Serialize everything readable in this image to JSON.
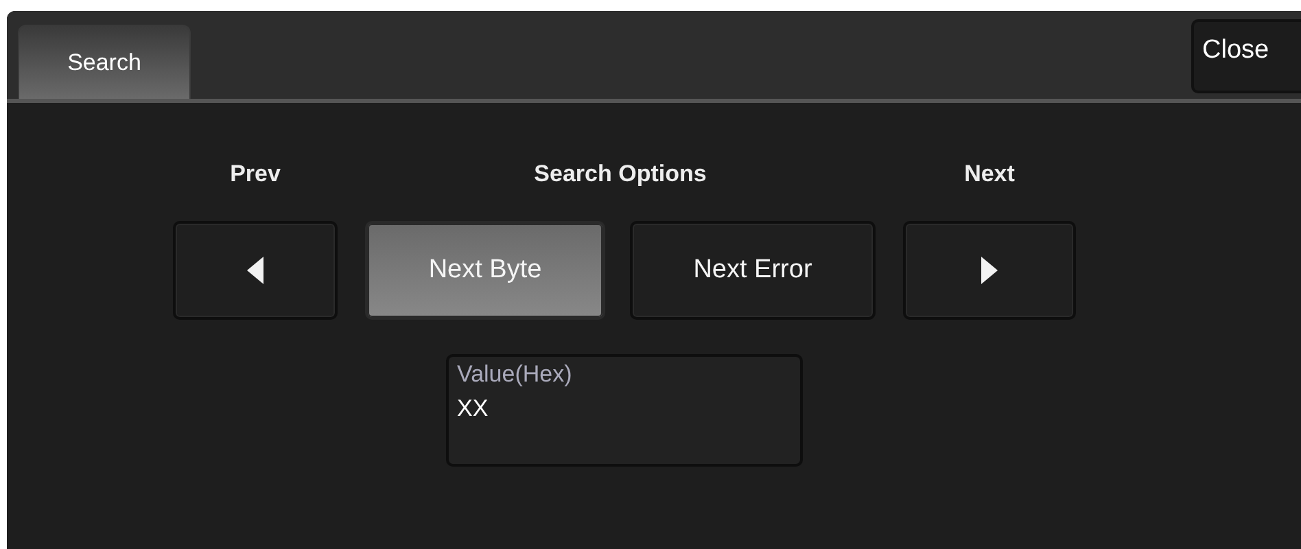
{
  "tabs": [
    {
      "label": "Search",
      "selected": true
    }
  ],
  "close_button": {
    "label": "Close"
  },
  "headers": {
    "prev": "Prev",
    "options": "Search Options",
    "next": "Next"
  },
  "search_options": [
    {
      "label": "Next Byte",
      "selected": true
    },
    {
      "label": "Next Error",
      "selected": false
    }
  ],
  "value_field": {
    "label": "Value(Hex)",
    "value": "XX"
  }
}
